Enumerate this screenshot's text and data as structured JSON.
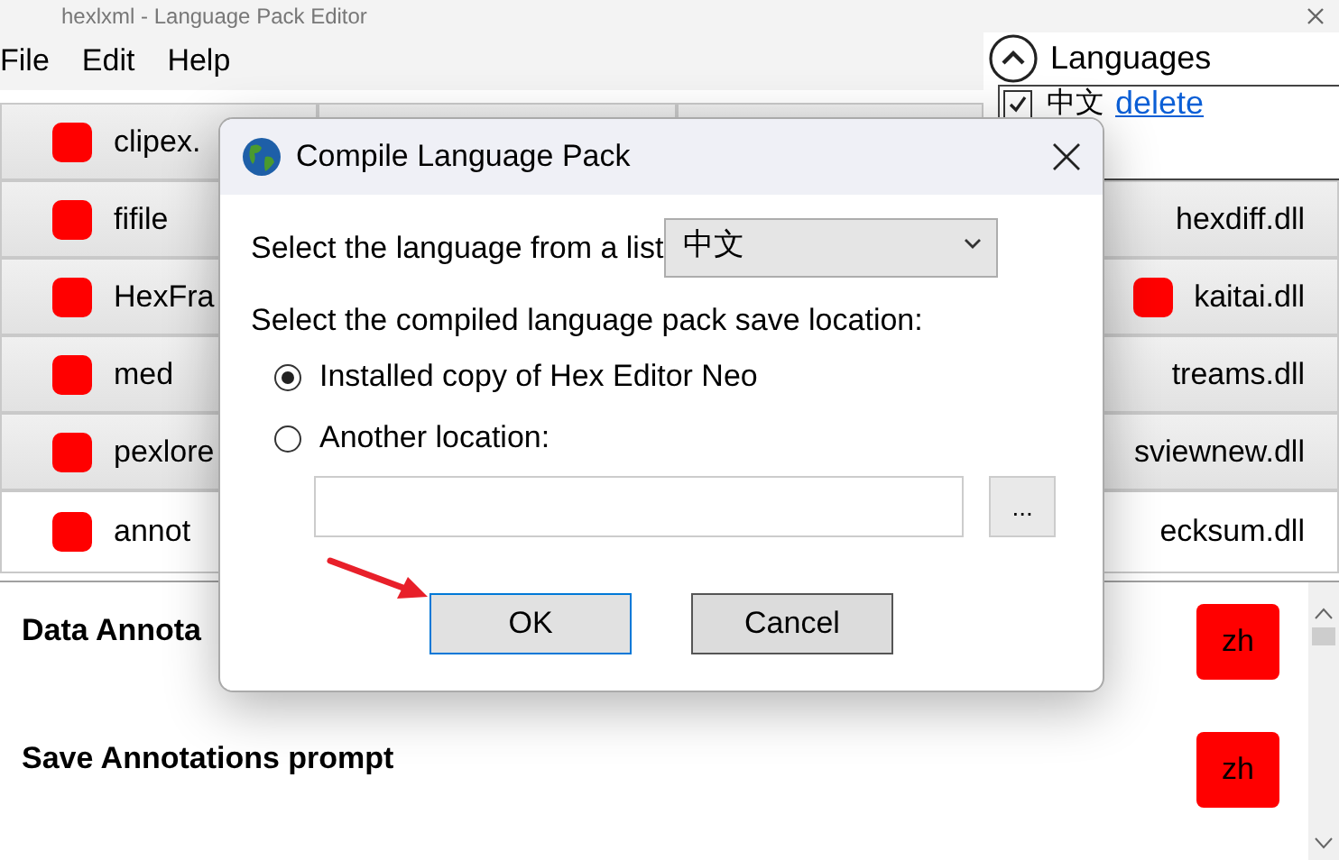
{
  "window": {
    "title": "hexlxml - Language Pack Editor"
  },
  "menu": [
    {
      "label": "File"
    },
    {
      "label": "Edit"
    },
    {
      "label": "Help"
    }
  ],
  "languages_panel": {
    "title": "Languages",
    "expanded": true,
    "items": [
      {
        "label": "中文",
        "checked": true,
        "action": "delete"
      }
    ]
  },
  "modules": [
    {
      "left": {
        "label": "clipex.",
        "icon": true
      },
      "selected": false
    },
    {
      "left": {
        "label": "fifile",
        "icon": true
      },
      "right": {
        "label": "hexdiff.dll",
        "icon": false
      },
      "selected": false
    },
    {
      "left": {
        "label": "HexFra",
        "icon": true
      },
      "right": {
        "label": "kaitai.dll",
        "icon": true
      },
      "selected": false
    },
    {
      "left": {
        "label": "med",
        "icon": true
      },
      "right": {
        "label": "treams.dll",
        "icon": false
      },
      "selected": false
    },
    {
      "left": {
        "label": "pexlore",
        "icon": true
      },
      "right": {
        "label": "sviewnew.dll",
        "icon": false
      },
      "selected": false
    },
    {
      "left": {
        "label": "annot",
        "icon": true
      },
      "right": {
        "label": "ecksum.dll",
        "icon": false
      },
      "selected": true
    }
  ],
  "annotations": [
    {
      "label": "Data Annota",
      "lang": "zh"
    },
    {
      "label": "Save Annotations prompt",
      "lang": "zh"
    }
  ],
  "dialog": {
    "title": "Compile Language Pack",
    "language_label": "Select the language from a list",
    "language": "中文",
    "location_label": "Select the compiled language pack save location:",
    "options": [
      {
        "label": "Installed copy of Hex Editor Neo",
        "selected": true
      },
      {
        "label": "Another location:",
        "selected": false
      }
    ],
    "browse": "...",
    "buttons": [
      {
        "label": "OK",
        "focused": true
      },
      {
        "label": "Cancel",
        "focused": false
      }
    ]
  }
}
